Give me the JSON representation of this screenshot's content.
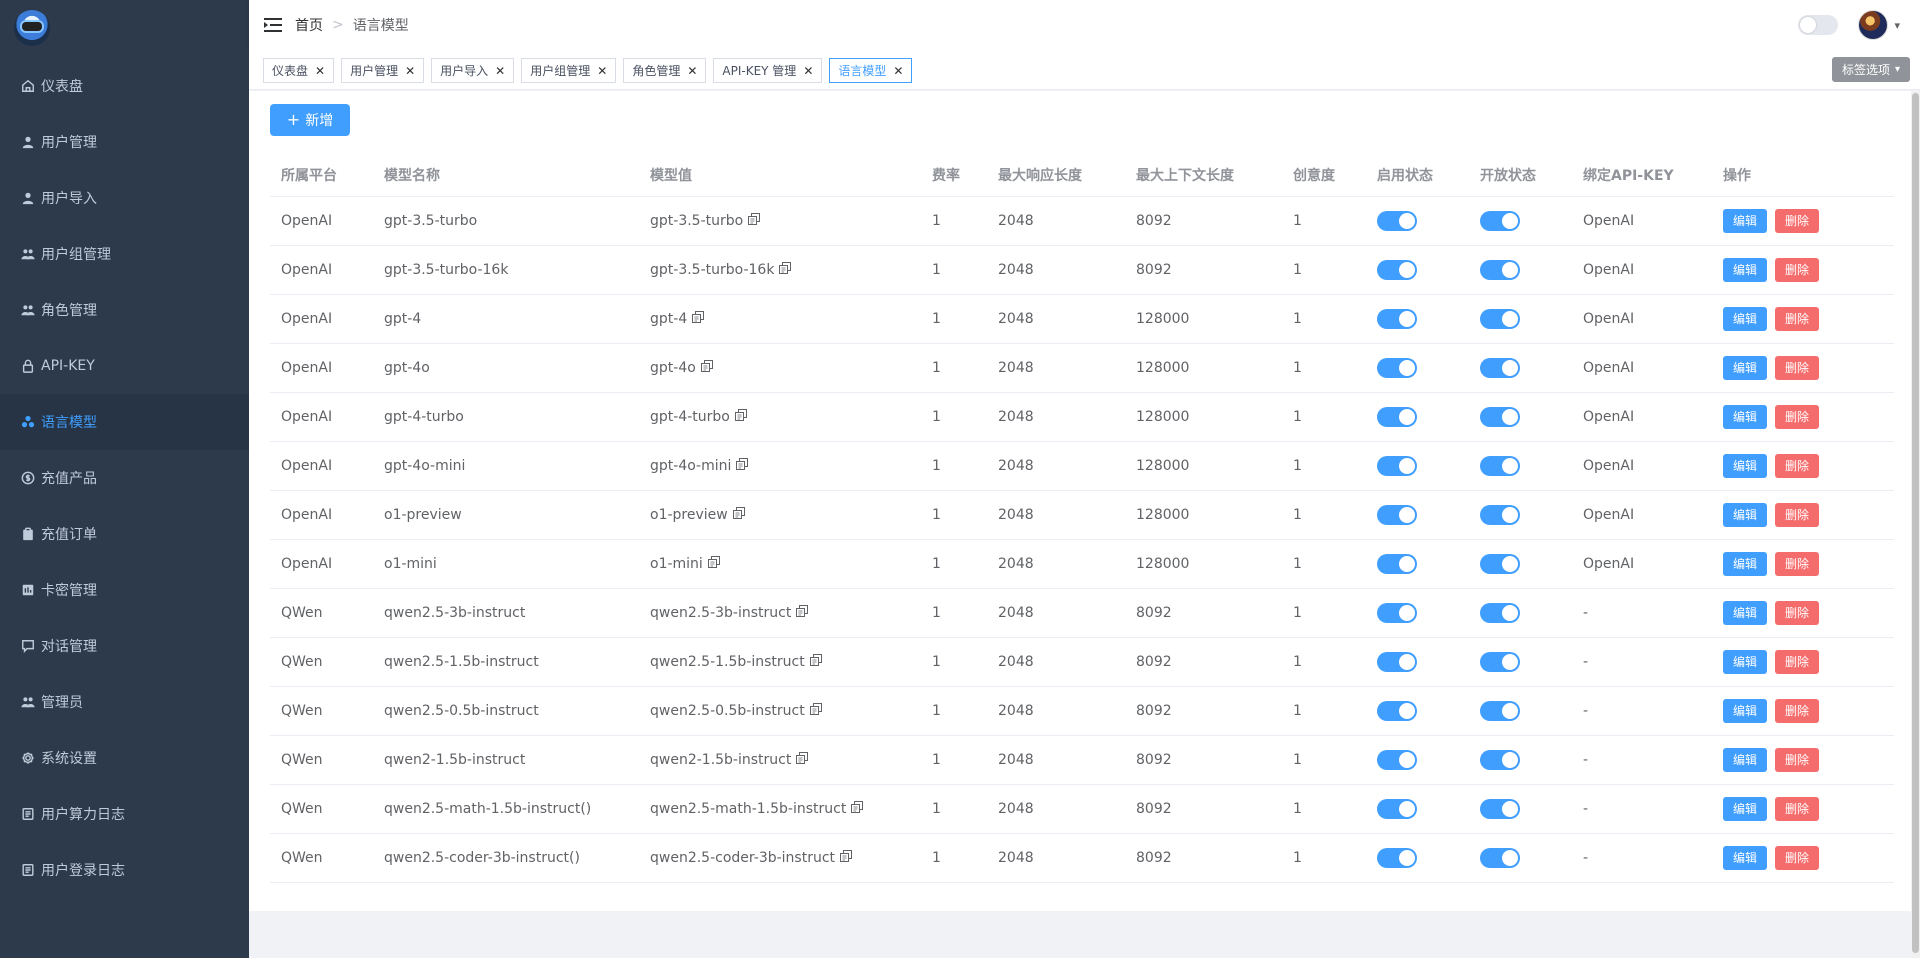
{
  "sidebar": {
    "items": [
      {
        "label": "仪表盘",
        "icon": "home-icon",
        "active": false
      },
      {
        "label": "用户管理",
        "icon": "user-icon",
        "active": false
      },
      {
        "label": "用户导入",
        "icon": "user-icon",
        "active": false
      },
      {
        "label": "用户组管理",
        "icon": "group-icon",
        "active": false
      },
      {
        "label": "角色管理",
        "icon": "group-icon",
        "active": false
      },
      {
        "label": "API-KEY",
        "icon": "lock-icon",
        "active": false
      },
      {
        "label": "语言模型",
        "icon": "model-icon",
        "active": true
      },
      {
        "label": "充值产品",
        "icon": "money-icon",
        "active": false
      },
      {
        "label": "充值订单",
        "icon": "clipboard-icon",
        "active": false
      },
      {
        "label": "卡密管理",
        "icon": "card-icon",
        "active": false
      },
      {
        "label": "对话管理",
        "icon": "chat-icon",
        "active": false
      },
      {
        "label": "管理员",
        "icon": "group-icon",
        "active": false
      },
      {
        "label": "系统设置",
        "icon": "gear-icon",
        "active": false
      },
      {
        "label": "用户算力日志",
        "icon": "log-icon",
        "active": false
      },
      {
        "label": "用户登录日志",
        "icon": "log-icon",
        "active": false
      }
    ]
  },
  "breadcrumb": {
    "home": "首页",
    "separator": ">",
    "current": "语言模型"
  },
  "tags": [
    {
      "label": "仪表盘",
      "active": false
    },
    {
      "label": "用户管理",
      "active": false
    },
    {
      "label": "用户导入",
      "active": false
    },
    {
      "label": "用户组管理",
      "active": false
    },
    {
      "label": "角色管理",
      "active": false
    },
    {
      "label": "API-KEY 管理",
      "active": false
    },
    {
      "label": "语言模型",
      "active": true
    }
  ],
  "tag_options_label": "标签选项",
  "add_button_label": "新增",
  "table": {
    "headers": [
      "所属平台",
      "模型名称",
      "模型值",
      "费率",
      "最大响应长度",
      "最大上下文长度",
      "创意度",
      "启用状态",
      "开放状态",
      "绑定API-KEY",
      "操作"
    ],
    "edit_label": "编辑",
    "delete_label": "删除",
    "rows": [
      {
        "platform": "OpenAI",
        "name": "gpt-3.5-turbo",
        "value": "gpt-3.5-turbo",
        "rate": "1",
        "max_response": "2048",
        "max_context": "8092",
        "creativity": "1",
        "enabled": true,
        "open": true,
        "api_key": "OpenAI"
      },
      {
        "platform": "OpenAI",
        "name": "gpt-3.5-turbo-16k",
        "value": "gpt-3.5-turbo-16k",
        "rate": "1",
        "max_response": "2048",
        "max_context": "8092",
        "creativity": "1",
        "enabled": true,
        "open": true,
        "api_key": "OpenAI"
      },
      {
        "platform": "OpenAI",
        "name": "gpt-4",
        "value": "gpt-4",
        "rate": "1",
        "max_response": "2048",
        "max_context": "128000",
        "creativity": "1",
        "enabled": true,
        "open": true,
        "api_key": "OpenAI"
      },
      {
        "platform": "OpenAI",
        "name": "gpt-4o",
        "value": "gpt-4o",
        "rate": "1",
        "max_response": "2048",
        "max_context": "128000",
        "creativity": "1",
        "enabled": true,
        "open": true,
        "api_key": "OpenAI"
      },
      {
        "platform": "OpenAI",
        "name": "gpt-4-turbo",
        "value": "gpt-4-turbo",
        "rate": "1",
        "max_response": "2048",
        "max_context": "128000",
        "creativity": "1",
        "enabled": true,
        "open": true,
        "api_key": "OpenAI"
      },
      {
        "platform": "OpenAI",
        "name": "gpt-4o-mini",
        "value": "gpt-4o-mini",
        "rate": "1",
        "max_response": "2048",
        "max_context": "128000",
        "creativity": "1",
        "enabled": true,
        "open": true,
        "api_key": "OpenAI"
      },
      {
        "platform": "OpenAI",
        "name": "o1-preview",
        "value": "o1-preview",
        "rate": "1",
        "max_response": "2048",
        "max_context": "128000",
        "creativity": "1",
        "enabled": true,
        "open": true,
        "api_key": "OpenAI"
      },
      {
        "platform": "OpenAI",
        "name": "o1-mini",
        "value": "o1-mini",
        "rate": "1",
        "max_response": "2048",
        "max_context": "128000",
        "creativity": "1",
        "enabled": true,
        "open": true,
        "api_key": "OpenAI"
      },
      {
        "platform": "QWen",
        "name": "qwen2.5-3b-instruct",
        "value": "qwen2.5-3b-instruct",
        "rate": "1",
        "max_response": "2048",
        "max_context": "8092",
        "creativity": "1",
        "enabled": true,
        "open": true,
        "api_key": "-"
      },
      {
        "platform": "QWen",
        "name": "qwen2.5-1.5b-instruct",
        "value": "qwen2.5-1.5b-instruct",
        "rate": "1",
        "max_response": "2048",
        "max_context": "8092",
        "creativity": "1",
        "enabled": true,
        "open": true,
        "api_key": "-"
      },
      {
        "platform": "QWen",
        "name": "qwen2.5-0.5b-instruct",
        "value": "qwen2.5-0.5b-instruct",
        "rate": "1",
        "max_response": "2048",
        "max_context": "8092",
        "creativity": "1",
        "enabled": true,
        "open": true,
        "api_key": "-"
      },
      {
        "platform": "QWen",
        "name": "qwen2-1.5b-instruct",
        "value": "qwen2-1.5b-instruct",
        "rate": "1",
        "max_response": "2048",
        "max_context": "8092",
        "creativity": "1",
        "enabled": true,
        "open": true,
        "api_key": "-"
      },
      {
        "platform": "QWen",
        "name": "qwen2.5-math-1.5b-instruct()",
        "value": "qwen2.5-math-1.5b-instruct",
        "rate": "1",
        "max_response": "2048",
        "max_context": "8092",
        "creativity": "1",
        "enabled": true,
        "open": true,
        "api_key": "-"
      },
      {
        "platform": "QWen",
        "name": "qwen2.5-coder-3b-instruct()",
        "value": "qwen2.5-coder-3b-instruct",
        "rate": "1",
        "max_response": "2048",
        "max_context": "8092",
        "creativity": "1",
        "enabled": true,
        "open": true,
        "api_key": "-"
      }
    ]
  },
  "colors": {
    "primary": "#409eff",
    "danger": "#f56c6c",
    "sidebar_bg": "#2d3a4b",
    "sidebar_text": "#bfcbd9"
  }
}
